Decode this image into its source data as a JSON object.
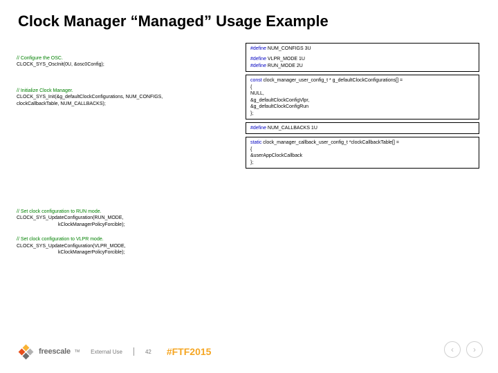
{
  "title": "Clock Manager “Managed” Usage Example",
  "left": {
    "b1c": "// Configure the OSC.",
    "b1l": "CLOCK_SYS_OscInit(0U, &osc0Config);",
    "b2c": "// Initialize Clock Manager.",
    "b2l1": "CLOCK_SYS_Init(&g_defaultClockConfigurations, NUM_CONFIGS,",
    "b2l2": "clockCallbackTable, NUM_CALLBACKS);"
  },
  "right": {
    "box1_l1a": "#define",
    "box1_l1b": " NUM_CONFIGS  3U",
    "box1_l2a": "#define",
    "box1_l2b": " VLPR_MODE    1U",
    "box1_l3a": "#define",
    "box1_l3b": " RUN_MODE     2U",
    "box2_kw": "const",
    "box2_l1": " clock_manager_user_config_t * g_defaultClockConfigurations[] =",
    "box2_l2": "{",
    "box2_l3": "    NULL,",
    "box2_l4": "    &g_defaultClockConfigVlpr,",
    "box2_l5": "    &g_defaultClockConfigRun",
    "box2_l6": "};",
    "box3_a": "#define",
    "box3_b": " NUM_CALLBACKS  1U",
    "box4_kw": "static",
    "box4_l1": " clock_manager_callback_user_config_t *clockCallbackTable[] =",
    "box4_l2": "{",
    "box4_l3": "    &userAppClockCallback",
    "box4_l4": "};"
  },
  "set": {
    "s1c": "// Set clock configuration to RUN mode.",
    "s1l": "CLOCK_SYS_UpdateConfiguration(RUN_MODE,",
    "s1l2": "kClockManagerPolicyForcible);",
    "s2c": "// Set clock configuration to VLPR mode.",
    "s2l": "CLOCK_SYS_UpdateConfiguration(VLPR_MODE,",
    "s2l2": "kClockManagerPolicyForcible);"
  },
  "footer": {
    "brand": "freescale",
    "tm": "TM",
    "ext": "External Use",
    "page": "42",
    "tag": "#FTF2015"
  },
  "nav": {
    "prev": "‹",
    "next": "›"
  }
}
